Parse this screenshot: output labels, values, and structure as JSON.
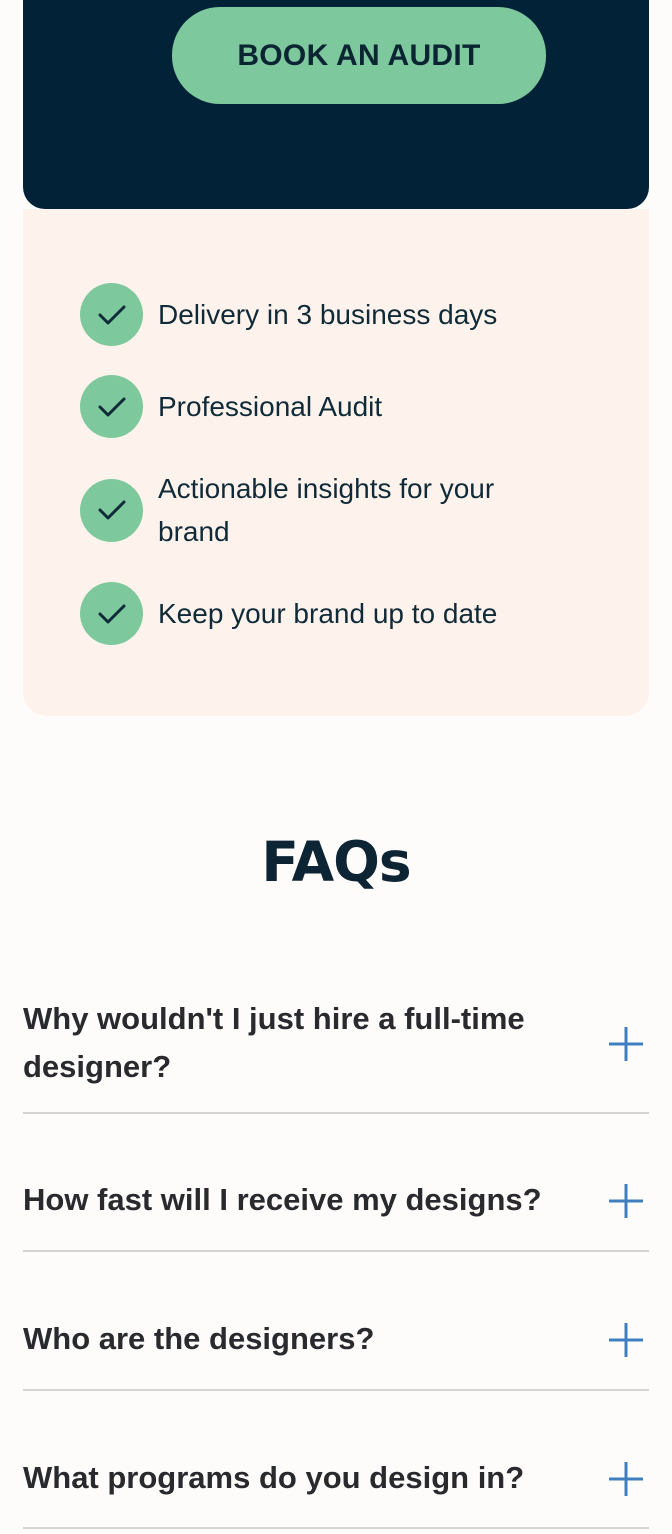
{
  "cta": {
    "button_label": "BOOK AN AUDIT"
  },
  "features": [
    {
      "label": "Delivery in 3 business days",
      "icon": "check-icon"
    },
    {
      "label": "Professional Audit",
      "icon": "check-icon"
    },
    {
      "label": "Actionable insights for your brand",
      "icon": "check-icon"
    },
    {
      "label": "Keep your brand up to date",
      "icon": "check-icon"
    }
  ],
  "faq": {
    "title": "FAQs",
    "items": [
      {
        "question": "Why wouldn't I just hire a full-time designer?",
        "icon": "plus-icon"
      },
      {
        "question": "How fast will I receive my designs?",
        "icon": "plus-icon"
      },
      {
        "question": "Who are the designers?",
        "icon": "plus-icon"
      },
      {
        "question": "What programs do you design in?",
        "icon": "plus-icon"
      }
    ]
  },
  "colors": {
    "navy": "#012237",
    "accent_green": "#7ec89d",
    "cream": "#fdf3ec",
    "plus_blue": "#3f7fc0"
  }
}
